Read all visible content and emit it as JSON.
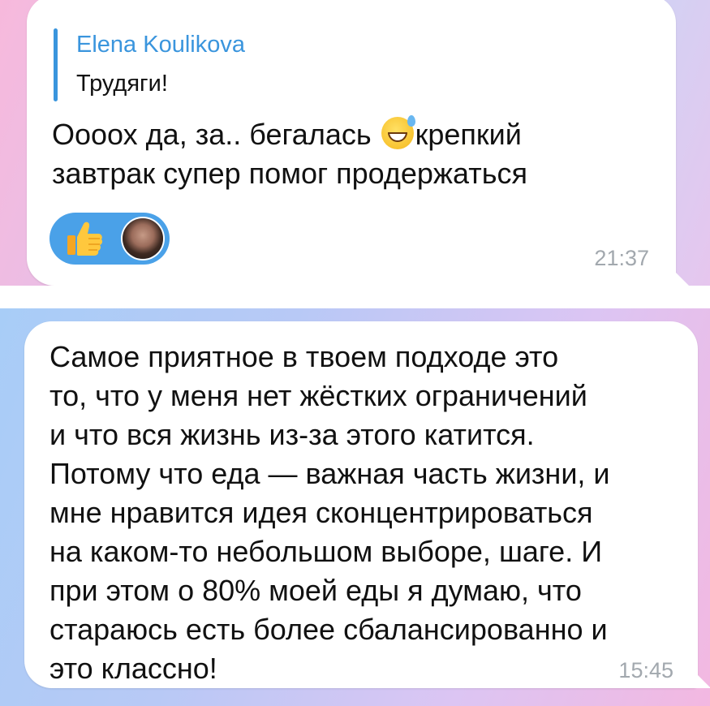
{
  "message_top": {
    "reply": {
      "author": "Elena Koulikova",
      "text": "Трудяги!"
    },
    "text_before_emoji": "Оооох да, за.. бегалась ",
    "emoji_icon": "grinning-face-with-sweat-icon",
    "text_after_emoji": "крепкий\nзавтрак супер помог продержаться",
    "reactions": {
      "emoji_icon": "thumbs-up-icon",
      "reactor": "avatar"
    },
    "time": "21:37"
  },
  "message_bottom": {
    "text": "Самое приятное в твоем подходе это\nто, что у меня нет жёстких ограничений\nи что вся жизнь из-за этого катится.\nПотому что еда — важная часть жизни, и\nмне нравится идея сконцентрироваться\nна каком-то небольшом выборе, шаге. И\nпри этом о 80% моей еды я думаю, что\nстараюсь есть более сбалансированно и\nэто классно!",
    "time": "15:45"
  },
  "colors": {
    "accent": "#3a95dd",
    "reaction_bg": "#4aa1e8",
    "time_text": "#a2a8ae"
  }
}
